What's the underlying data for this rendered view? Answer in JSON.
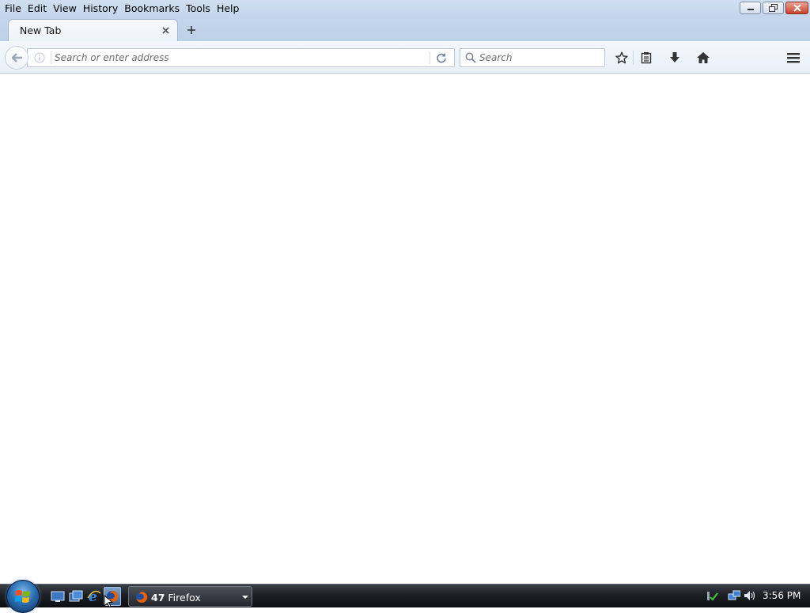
{
  "menu": {
    "items": [
      "File",
      "Edit",
      "View",
      "History",
      "Bookmarks",
      "Tools",
      "Help"
    ]
  },
  "window_controls": {
    "minimize": "minimize-icon",
    "restore": "restore-icon",
    "close": "close-icon"
  },
  "tabs": [
    {
      "label": "New Tab",
      "active": true
    }
  ],
  "navbar": {
    "url_placeholder": "Search or enter address",
    "search_placeholder": "Search"
  },
  "taskbar": {
    "task": {
      "count": "47",
      "label": "Firefox"
    },
    "clock": "3:56 PM"
  },
  "colors": {
    "accent": "#2b6fb5",
    "tab_bg": "#c4d6ec",
    "close_red": "#c8412a",
    "firefox_orange": "#e66000"
  }
}
